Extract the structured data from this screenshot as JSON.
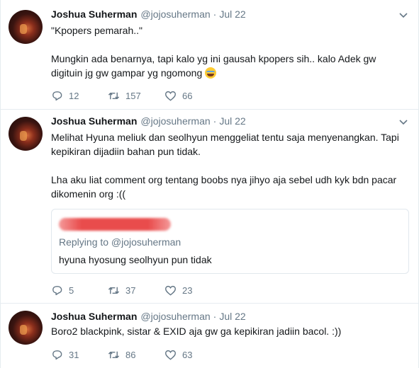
{
  "tweets": [
    {
      "name": "Joshua Suherman",
      "handle": "@jojosuherman",
      "separator": "·",
      "time": "Jul 22",
      "paragraphs": [
        "\"Kpopers pemarah..\"",
        "Mungkin ada benarnya, tapi kalo yg ini gausah kpopers sih.. kalo Adek gw digituin jg gw gampar yg ngomong"
      ],
      "emoji": "face-with-tears-of-joy",
      "replies": "12",
      "retweets": "157",
      "likes": "66"
    },
    {
      "name": "Joshua Suherman",
      "handle": "@jojosuherman",
      "separator": "·",
      "time": "Jul 22",
      "paragraphs": [
        "Melihat Hyuna meliuk dan seolhyun menggeliat tentu saja menyenangkan. Tapi kepikiran dijadiin bahan pun tidak.",
        "Lha aku liat comment org tentang boobs nya jihyo aja sebel udh kyk bdn pacar dikomenin org :(("
      ],
      "quote": {
        "replying_to": "Replying to @jojosuherman",
        "text": "hyuna hyosung seolhyun pun tidak"
      },
      "replies": "5",
      "retweets": "37",
      "likes": "23"
    },
    {
      "name": "Joshua Suherman",
      "handle": "@jojosuherman",
      "separator": "·",
      "time": "Jul 22",
      "paragraphs": [
        "Boro2 blackpink, sistar & EXID aja gw ga kepikiran jadiin bacol. :))"
      ],
      "replies": "31",
      "retweets": "86",
      "likes": "63"
    }
  ],
  "icons": {
    "reply": "reply-icon",
    "retweet": "retweet-icon",
    "like": "heart-icon",
    "caret": "chevron-down-icon"
  },
  "colors": {
    "text": "#14171a",
    "secondary": "#657786",
    "border": "#e6ecf0",
    "redaction": "#e94c4c"
  }
}
